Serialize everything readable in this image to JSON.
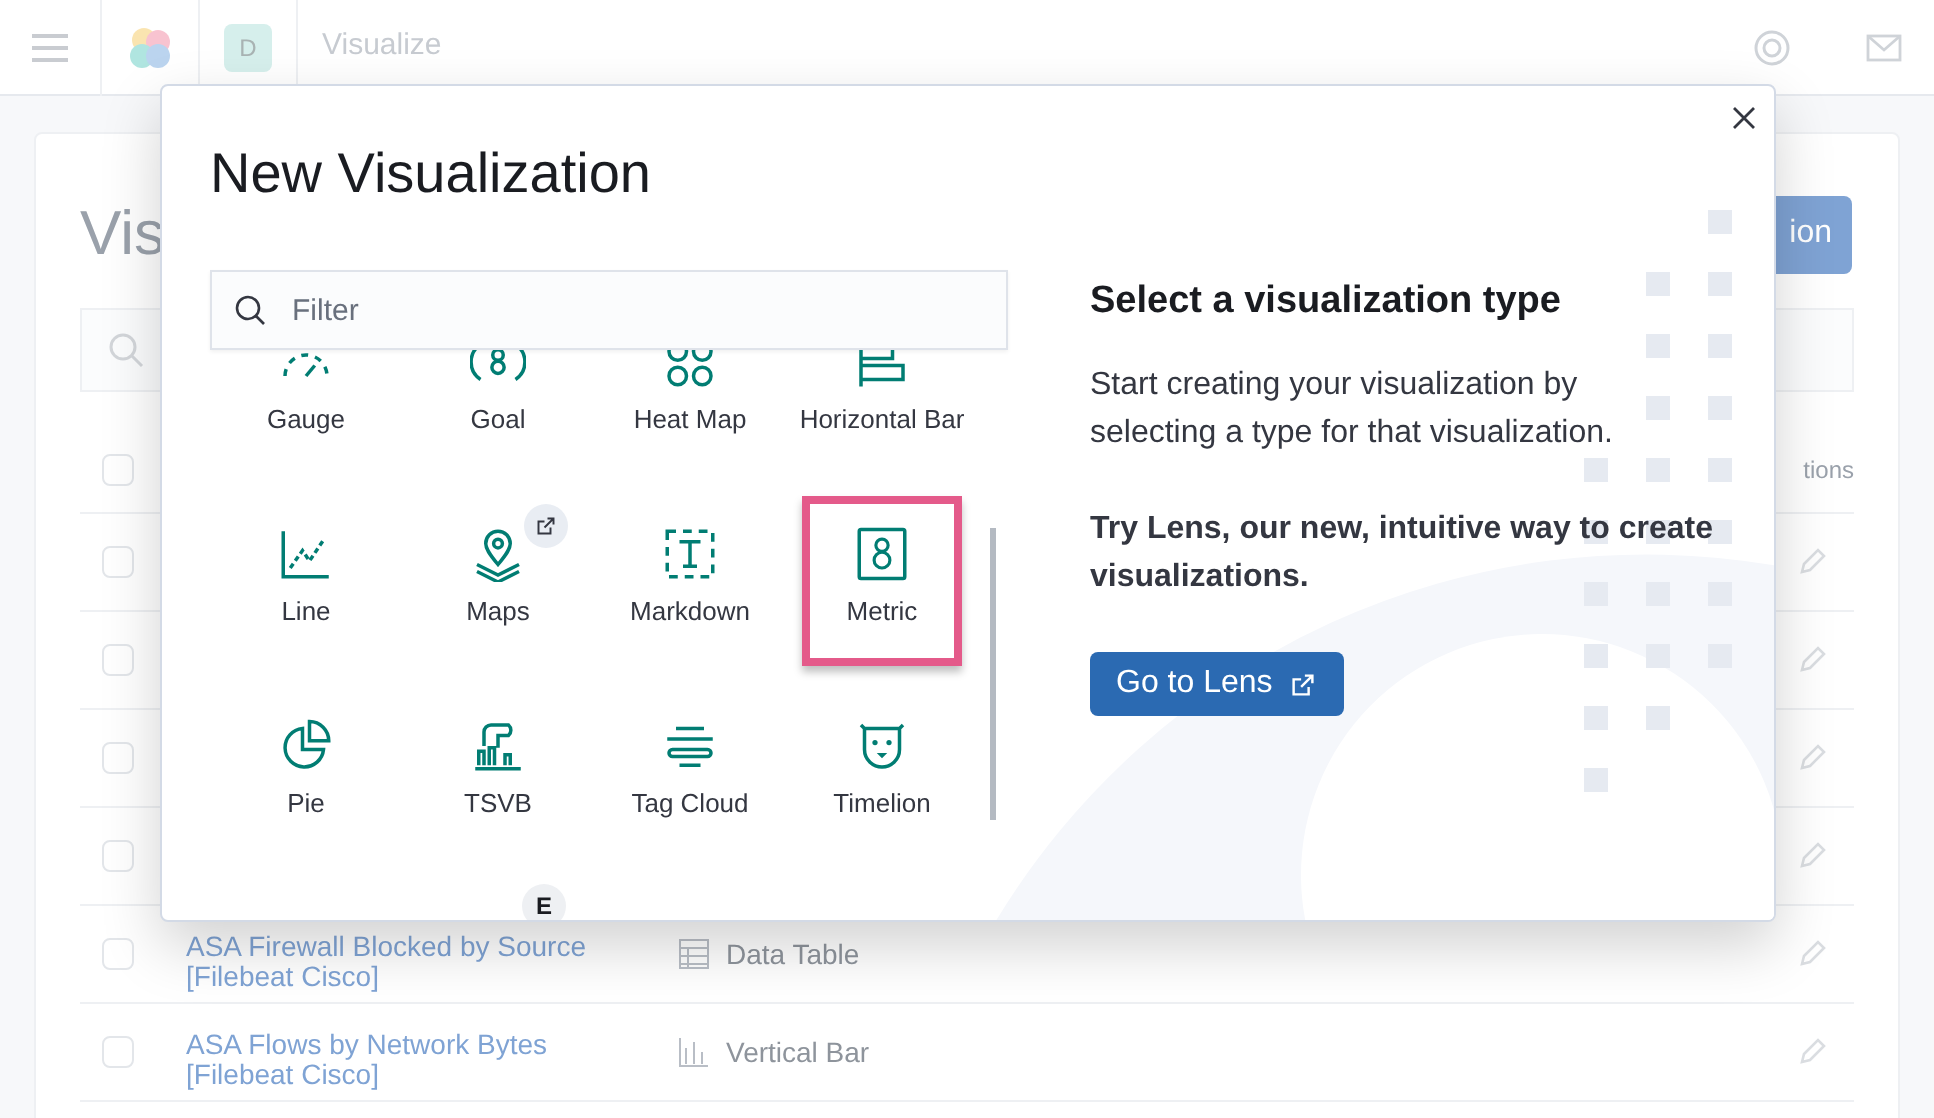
{
  "header": {
    "avatar": "D",
    "breadcrumb": "Visualize"
  },
  "page": {
    "title": "Vis",
    "create_button": "ion",
    "actions_column": "tions",
    "select_all_checked": false,
    "rows": [
      {
        "checked": false
      },
      {
        "checked": false
      },
      {
        "checked": false
      },
      {
        "checked": false
      },
      {
        "title": "ASA Firewall Blocked by Source [Filebeat Cisco]",
        "type": "Data Table",
        "checked": false
      },
      {
        "title": "ASA Flows by Network Bytes [Filebeat Cisco]",
        "type": "Vertical Bar",
        "checked": false
      }
    ]
  },
  "modal": {
    "title": "New Visualization",
    "filter": {
      "placeholder": "Filter"
    },
    "types": [
      {
        "label": "Gauge",
        "selected": false,
        "external": false
      },
      {
        "label": "Goal",
        "selected": false,
        "external": false
      },
      {
        "label": "Heat Map",
        "selected": false,
        "external": false
      },
      {
        "label": "Horizontal Bar",
        "selected": false,
        "external": false
      },
      {
        "label": "Line",
        "selected": false,
        "external": false
      },
      {
        "label": "Maps",
        "selected": false,
        "external": true
      },
      {
        "label": "Markdown",
        "selected": false,
        "external": false
      },
      {
        "label": "Metric",
        "selected": true,
        "external": false
      },
      {
        "label": "Pie",
        "selected": false,
        "external": false
      },
      {
        "label": "TSVB",
        "selected": false,
        "external": false
      },
      {
        "label": "Tag Cloud",
        "selected": false,
        "external": false
      },
      {
        "label": "Timelion",
        "selected": false,
        "external": false
      }
    ],
    "tooltip": "E",
    "info": {
      "heading": "Select a visualization type",
      "body": "Start creating your visualization by selecting a type for that visualization.",
      "lens_prompt": "Try Lens, our new, intuitive way to create visualizations.",
      "lens_button": "Go to Lens"
    }
  }
}
